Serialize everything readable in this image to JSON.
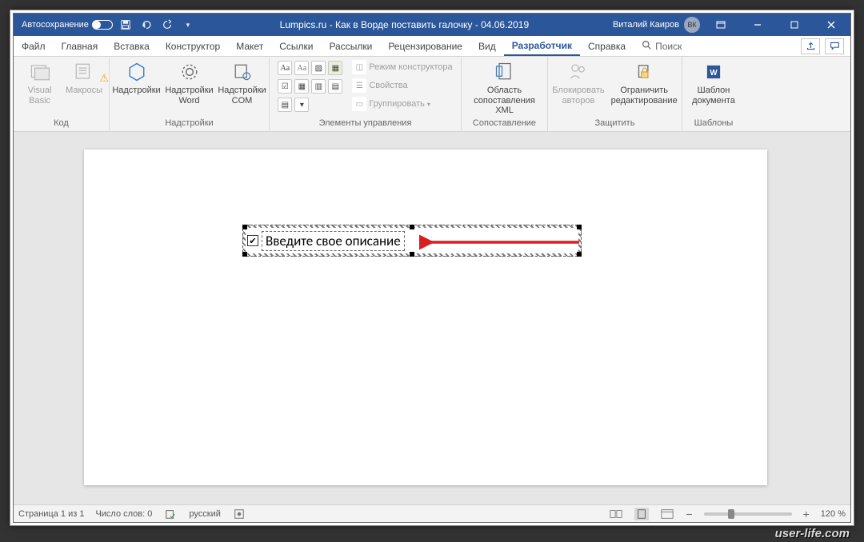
{
  "title": {
    "autosave_label": "Автосохранение",
    "document_title": "Lumpics.ru - Как в Ворде поставить галочку  -  04.06.2019",
    "user_name": "Виталий Каиров",
    "user_initials": "ВК"
  },
  "tabs": {
    "file": "Файл",
    "home": "Главная",
    "insert": "Вставка",
    "design": "Конструктор",
    "layout": "Макет",
    "references": "Ссылки",
    "mailings": "Рассылки",
    "review": "Рецензирование",
    "view": "Вид",
    "developer": "Разработчик",
    "help": "Справка",
    "search": "Поиск"
  },
  "ribbon": {
    "code_group": "Код",
    "visual_basic": "Visual Basic",
    "macros": "Макросы",
    "addins_group": "Надстройки",
    "addins": "Надстройки",
    "word_addins": "Надстройки Word",
    "com_addins": "Надстройки COM",
    "controls_group": "Элементы управления",
    "design_mode": "Режим конструктора",
    "properties": "Свойства",
    "group": "Группировать",
    "mapping_group": "Сопоставление",
    "xml_mapping": "Область сопоставления XML",
    "protect_group": "Защитить",
    "block_authors": "Блокировать авторов",
    "restrict_editing": "Ограничить редактирование",
    "templates_group": "Шаблоны",
    "doc_template": "Шаблон документа"
  },
  "document": {
    "control_text": "Введите свое описание"
  },
  "status": {
    "page": "Страница 1 из 1",
    "words": "Число слов: 0",
    "language": "русский",
    "zoom": "120 %"
  },
  "watermark": "user-life.com"
}
